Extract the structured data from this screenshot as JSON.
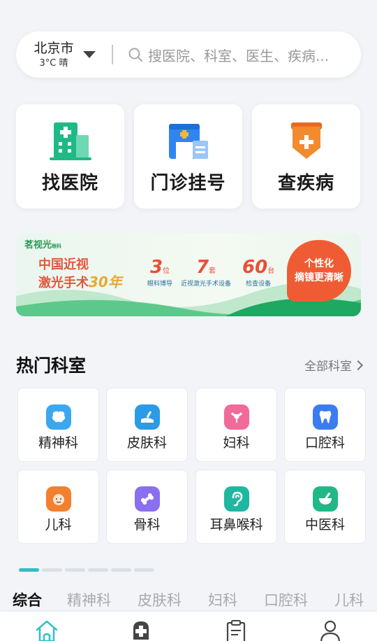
{
  "search": {
    "city": "北京市",
    "weather": "3°C 晴",
    "placeholder": "搜医院、科室、医生、疾病..."
  },
  "quick_actions": [
    {
      "label": "找医院",
      "icon": "hospital-building-icon"
    },
    {
      "label": "门诊挂号",
      "icon": "clinic-registration-icon"
    },
    {
      "label": "查疾病",
      "icon": "medical-shield-icon"
    }
  ],
  "banner": {
    "brand": "茗视光",
    "brand_sub": "眼科",
    "headline_line1": "中国近视",
    "headline_line2": "激光手术",
    "headline_years": "30年",
    "stats": [
      {
        "num": "3",
        "unit": "位",
        "caption": "眼科博导"
      },
      {
        "num": "7",
        "unit": "套",
        "caption": "近视激光手术设备"
      },
      {
        "num": "60",
        "unit": "台",
        "caption": "检查设备"
      }
    ],
    "badge_line1": "个性化",
    "badge_line2": "摘镜更清晰"
  },
  "departments": {
    "title": "热门科室",
    "more_label": "全部科室",
    "items": [
      {
        "label": "精神科",
        "icon": "brain-icon",
        "color": "#3aa7ee"
      },
      {
        "label": "皮肤科",
        "icon": "skin-care-icon",
        "color": "#2b9be6"
      },
      {
        "label": "妇科",
        "icon": "uterus-icon",
        "color": "#f06a9a"
      },
      {
        "label": "口腔科",
        "icon": "tooth-icon",
        "color": "#3b7cf0"
      },
      {
        "label": "儿科",
        "icon": "baby-face-icon",
        "color": "#f2802f"
      },
      {
        "label": "骨科",
        "icon": "bone-icon",
        "color": "#8a6ff0"
      },
      {
        "label": "耳鼻喉科",
        "icon": "ear-icon",
        "color": "#1fb7a0"
      },
      {
        "label": "中医科",
        "icon": "mortar-pestle-icon",
        "color": "#20b886"
      }
    ],
    "pages": 6,
    "active_page": 1
  },
  "category_tabs": [
    "综合",
    "精神科",
    "皮肤科",
    "妇科",
    "口腔科",
    "儿科"
  ],
  "active_category": "综合",
  "bottom_nav": [
    {
      "icon": "home-icon"
    },
    {
      "icon": "medical-cross-icon"
    },
    {
      "icon": "clipboard-icon"
    },
    {
      "icon": "user-icon"
    }
  ],
  "colors": {
    "accent": "#2ec1c4",
    "hospital_green": "#1fb986",
    "registration_blue": "#2f86f2",
    "disease_orange": "#f28a2e"
  }
}
